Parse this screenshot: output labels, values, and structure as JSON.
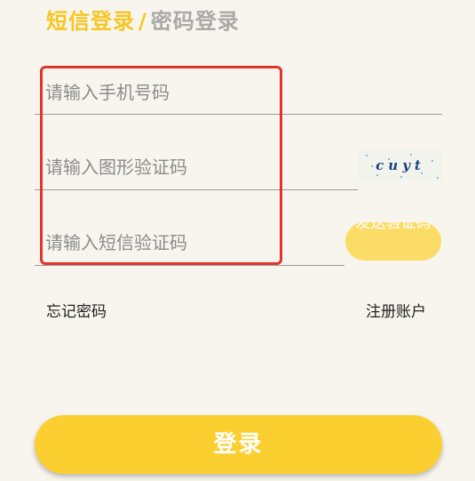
{
  "tabs": {
    "sms_login": "短信登录",
    "separator": "/",
    "password_login": "密码登录"
  },
  "form": {
    "phone_placeholder": "请输入手机号码",
    "image_code_placeholder": "请输入图形验证码",
    "sms_code_placeholder": "请输入短信验证码",
    "captcha_text": "cuyt",
    "send_code_label": "发送验证码"
  },
  "links": {
    "forgot_password": "忘记密码",
    "register": "注册账户"
  },
  "login_button": "登录",
  "colors": {
    "accent": "#fccf31",
    "highlight_border": "#e0342c",
    "background": "#f8f5ee"
  }
}
